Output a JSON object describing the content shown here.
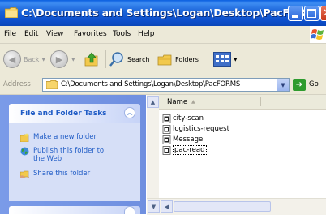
{
  "window": {
    "title": "C:\\Documents and Settings\\Logan\\Desktop\\PacFORMS"
  },
  "menu": [
    "File",
    "Edit",
    "View",
    "Favorites",
    "Tools",
    "Help"
  ],
  "toolbar": {
    "back_label": "Back",
    "search_label": "Search",
    "folders_label": "Folders"
  },
  "address": {
    "label": "Address",
    "value": "C:\\Documents and Settings\\Logan\\Desktop\\PacFORMS",
    "go_label": "Go"
  },
  "tasks": {
    "title": "File and Folder Tasks",
    "items": [
      "Make a new folder",
      "Publish this folder to the Web",
      "Share this folder"
    ]
  },
  "list": {
    "column_name": "Name",
    "files": [
      "city-scan",
      "logistics-request",
      "Message",
      "pac-read"
    ],
    "selected": "pac-read"
  },
  "colors": {
    "titlebar": "#0a5fe0",
    "taskpane": "#7a9be8",
    "link": "#215dc6"
  }
}
